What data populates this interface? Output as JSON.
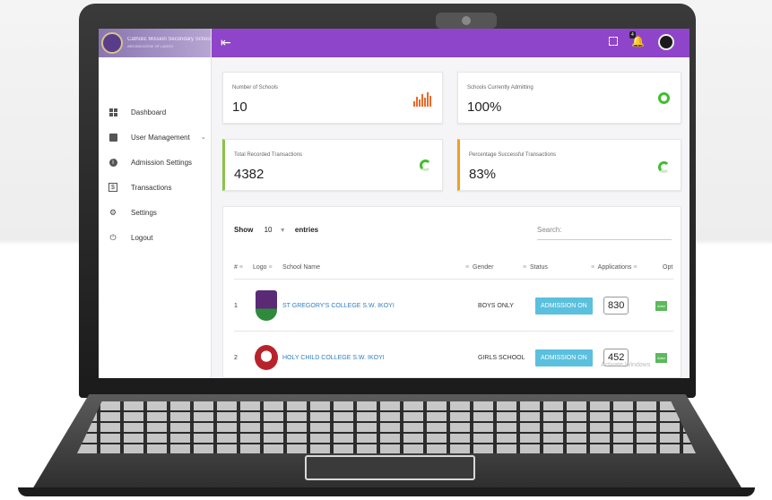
{
  "brand": {
    "name": "Catholic Mission Secondary Schools",
    "subtitle": "ARCHDIOCESE OF LAGOS"
  },
  "topbar": {
    "back_icon": "arrow-left-icon",
    "notification_count": "4"
  },
  "sidebar": {
    "items": [
      {
        "label": "Dashboard",
        "icon": "dashboard-icon"
      },
      {
        "label": "User Management",
        "icon": "user-icon"
      },
      {
        "label": "Admission Settings",
        "icon": "info-icon"
      },
      {
        "label": "Transactions",
        "icon": "dollar-icon"
      },
      {
        "label": "Settings",
        "icon": "gear-icon"
      },
      {
        "label": "Logout",
        "icon": "power-icon"
      }
    ]
  },
  "stats": {
    "schools": {
      "label": "Number of Schools",
      "value": "10",
      "icon": "bar-chart-icon"
    },
    "admitting": {
      "label": "Schools Currently Admitting",
      "value": "100%",
      "icon": "ring-icon"
    },
    "transactions": {
      "label": "Total Recorded Transactions",
      "value": "4382",
      "icon": "spinner-icon"
    },
    "success": {
      "label": "Percentage Successful Transactions",
      "value": "83%",
      "icon": "spinner-icon"
    }
  },
  "table": {
    "show_label": "Show",
    "entries_count": "10",
    "entries_label": "entries",
    "search_label": "Search:",
    "headers": {
      "num": "#",
      "logo": "Logo",
      "school": "School Name",
      "gender": "Gender",
      "status": "Status",
      "applications": "Applications",
      "options": "Opt"
    },
    "rows": [
      {
        "num": "1",
        "school": "ST GREGORY'S COLLEGE S.W. IKOYI",
        "gender": "BOYS ONLY",
        "status": "ADMISSION ON",
        "applications": "830",
        "option": "Admi"
      },
      {
        "num": "2",
        "school": "HOLY CHILD COLLEGE S.W. IKOYI",
        "gender": "GIRLS SCHOOL",
        "status": "ADMISSION ON",
        "applications": "452",
        "option": "Admi"
      }
    ]
  },
  "watermark": "Activate Windows",
  "colors": {
    "topbar": "#8e45c9",
    "status": "#5bc0de",
    "link": "#2f7fc1",
    "accent_green": "#8bc34a",
    "accent_orange": "#f0a020"
  }
}
